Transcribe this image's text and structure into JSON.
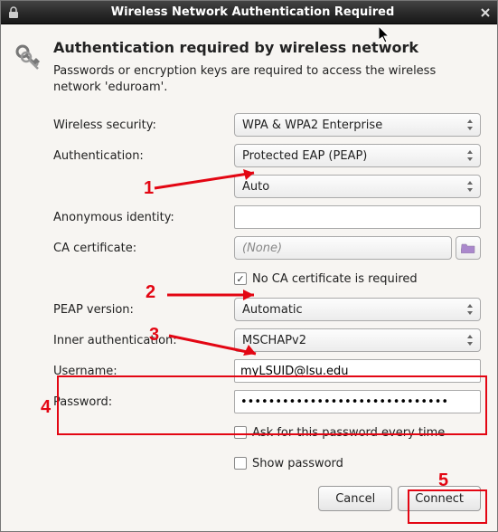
{
  "window": {
    "title": "Wireless Network Authentication Required"
  },
  "heading": "Authentication required by wireless network",
  "subtext": "Passwords or encryption keys are required to access the wireless network 'eduroam'.",
  "labels": {
    "wireless_security": "Wireless security:",
    "authentication": "Authentication:",
    "anonymous_identity": "Anonymous identity:",
    "ca_certificate": "CA certificate:",
    "no_ca_required": "No CA certificate is required",
    "peap_version": "PEAP version:",
    "inner_auth": "Inner authentication:",
    "username": "Username:",
    "password": "Password:",
    "ask_password": "Ask for this password every time",
    "show_password": "Show password"
  },
  "fields": {
    "wireless_security": "WPA & WPA2 Enterprise",
    "authentication": "Protected EAP (PEAP)",
    "tls_mode": "Auto",
    "anonymous_identity": "",
    "ca_certificate": "(None)",
    "peap_version": "Automatic",
    "inner_auth": "MSCHAPv2",
    "username": "myLSUID@lsu.edu",
    "password_masked": "••••••••••••••••••••••••••••••"
  },
  "checkboxes": {
    "no_ca_required": true,
    "ask_password": false,
    "show_password": false
  },
  "buttons": {
    "cancel": "Cancel",
    "connect": "Connect"
  },
  "annotations": {
    "n1": "1",
    "n2": "2",
    "n3": "3",
    "n4": "4",
    "n5": "5"
  }
}
